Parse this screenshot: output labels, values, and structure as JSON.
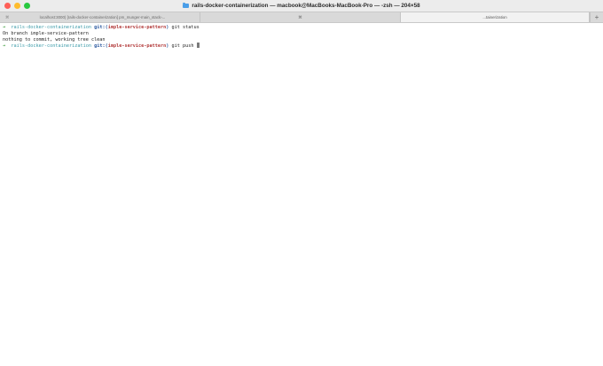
{
  "window": {
    "title": "rails-docker-containerization — macbook@MacBooks-MacBook-Pro — -zsh — 204×58"
  },
  "tabs": [
    {
      "label": "localhost:3000) [rails-docker-containerization] pm_munger-main_stack›...",
      "close": "⌘"
    },
    {
      "label": "⌘",
      "close": ""
    },
    {
      "label": "...tainerization",
      "close": ""
    }
  ],
  "new_tab_label": "+",
  "terminal": {
    "lines": [
      {
        "arrow": "➜",
        "dir": "rails-docker-containerization",
        "git": "git:(",
        "branch": "imple-service-pattern",
        "git_close": ")",
        "command": "git status"
      },
      {
        "output": "On branch imple-service-pattern"
      },
      {
        "output": "nothing to commit, working tree clean"
      },
      {
        "arrow": "➜",
        "dir": "rails-docker-containerization",
        "git": "git:(",
        "branch": "imple-service-pattern",
        "git_close": ")",
        "command": "git push"
      }
    ]
  },
  "colors": {
    "arrow": "#3a9a3a",
    "dir": "#3a9aa8",
    "git": "#2c5aa0",
    "branch": "#b23a3a"
  }
}
